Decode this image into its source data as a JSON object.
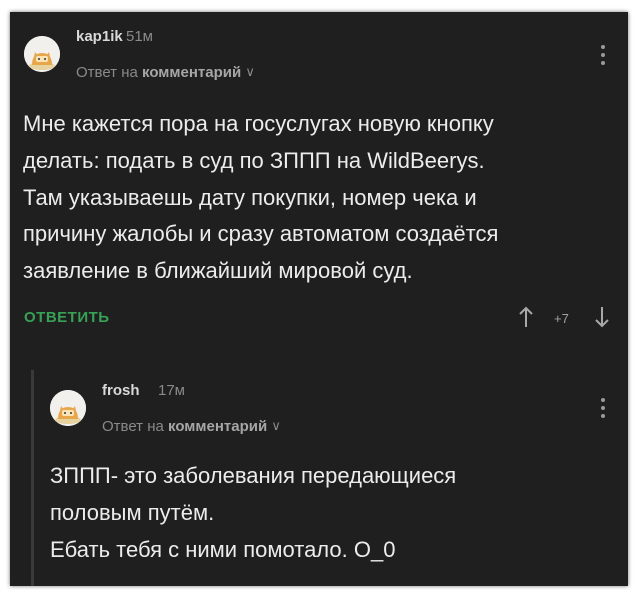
{
  "comments": [
    {
      "username": "kap1ik",
      "time": "51м",
      "reply_prefix": "Ответ на",
      "reply_target": "комментарий",
      "lines": [
        "Мне кажется пора на госуслугах новую кнопку",
        "делать: подать в суд по ЗППП на WildBeerys.",
        "Там указываешь дату покупки, номер чека и",
        "причину жалобы и сразу автоматом создаётся",
        "заявление в ближайший мировой суд."
      ],
      "reply_label": "ОТВЕТИТЬ",
      "rating": "+7"
    },
    {
      "username": "frosh",
      "time": "17м",
      "reply_prefix": "Ответ на",
      "reply_target": "комментарий",
      "lines": [
        "ЗППП- это заболевания передающиеся",
        "половым путём.",
        "Ебать тебя с ними помотало. О_0"
      ]
    }
  ],
  "colors": {
    "background": "#1f1f1f",
    "accent_green": "#37a155",
    "text": "#ececec",
    "muted": "#8a8a8a"
  },
  "icons": [
    "cat-avatar-icon",
    "chevron-down-icon",
    "more-vertical-icon",
    "arrow-up-icon",
    "arrow-down-icon"
  ]
}
